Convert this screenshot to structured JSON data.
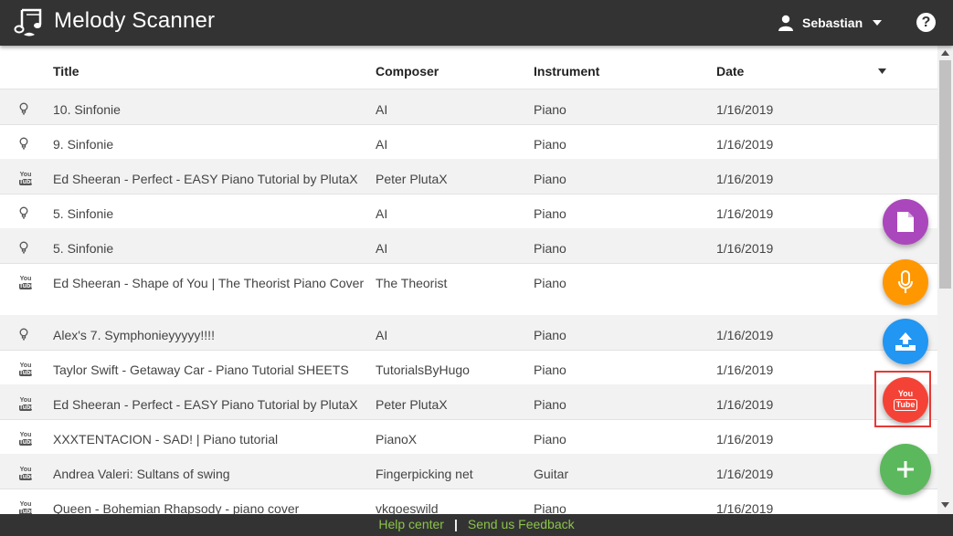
{
  "app": {
    "title": "Melody Scanner"
  },
  "user": {
    "name": "Sebastian"
  },
  "help": {
    "label": "?"
  },
  "table": {
    "headers": {
      "title": "Title",
      "composer": "Composer",
      "instrument": "Instrument",
      "date": "Date"
    },
    "rows": [
      {
        "type": "ai-bulb-icon",
        "title": "10. Sinfonie",
        "composer": "AI",
        "instrument": "Piano",
        "date": "1/16/2019"
      },
      {
        "type": "ai-bulb-icon",
        "title": "9. Sinfonie",
        "composer": "AI",
        "instrument": "Piano",
        "date": "1/16/2019"
      },
      {
        "type": "youtube-icon",
        "title": "Ed Sheeran - Perfect - EASY Piano Tutorial by PlutaX",
        "composer": "Peter PlutaX",
        "instrument": "Piano",
        "date": "1/16/2019"
      },
      {
        "type": "ai-bulb-icon",
        "title": "5. Sinfonie",
        "composer": "AI",
        "instrument": "Piano",
        "date": "1/16/2019"
      },
      {
        "type": "ai-bulb-icon",
        "title": "5. Sinfonie",
        "composer": "AI",
        "instrument": "Piano",
        "date": "1/16/2019"
      },
      {
        "type": "youtube-icon",
        "title": "Ed Sheeran - Shape of You | The Theorist Piano Cover",
        "composer": "The Theorist",
        "instrument": "Piano",
        "date": ""
      },
      {
        "type": "ai-bulb-icon",
        "title": "Alex's 7. Symphonieyyyyy!!!!",
        "composer": "AI",
        "instrument": "Piano",
        "date": "1/16/2019"
      },
      {
        "type": "youtube-icon",
        "title": "Taylor Swift - Getaway Car - Piano Tutorial SHEETS",
        "composer": "TutorialsByHugo",
        "instrument": "Piano",
        "date": "1/16/2019"
      },
      {
        "type": "youtube-icon",
        "title": "Ed Sheeran - Perfect - EASY Piano Tutorial by PlutaX",
        "composer": "Peter PlutaX",
        "instrument": "Piano",
        "date": "1/16/2019"
      },
      {
        "type": "youtube-icon",
        "title": "XXXTENTACION - SAD! | Piano tutorial",
        "composer": "PianoX",
        "instrument": "Piano",
        "date": "1/16/2019"
      },
      {
        "type": "youtube-icon",
        "title": "Andrea Valeri: Sultans of swing",
        "composer": "Fingerpicking net",
        "instrument": "Guitar",
        "date": "1/16/2019"
      },
      {
        "type": "youtube-icon",
        "title": "Queen - Bohemian Rhapsody - piano cover",
        "composer": "vkgoeswild",
        "instrument": "Piano",
        "date": "1/16/2019"
      }
    ]
  },
  "youtube_icon_text": {
    "top": "You",
    "bottom": "Tube"
  },
  "fabs": [
    {
      "name": "new-document-icon",
      "color": "#ab47bc"
    },
    {
      "name": "microphone-icon",
      "color": "#ff9800"
    },
    {
      "name": "upload-icon",
      "color": "#2196f3"
    },
    {
      "name": "youtube-icon",
      "color": "#f44336"
    },
    {
      "name": "plus-icon",
      "color": "#5cb85c"
    }
  ],
  "footer": {
    "help_center": "Help center",
    "separator": "|",
    "feedback": "Send us Feedback"
  }
}
